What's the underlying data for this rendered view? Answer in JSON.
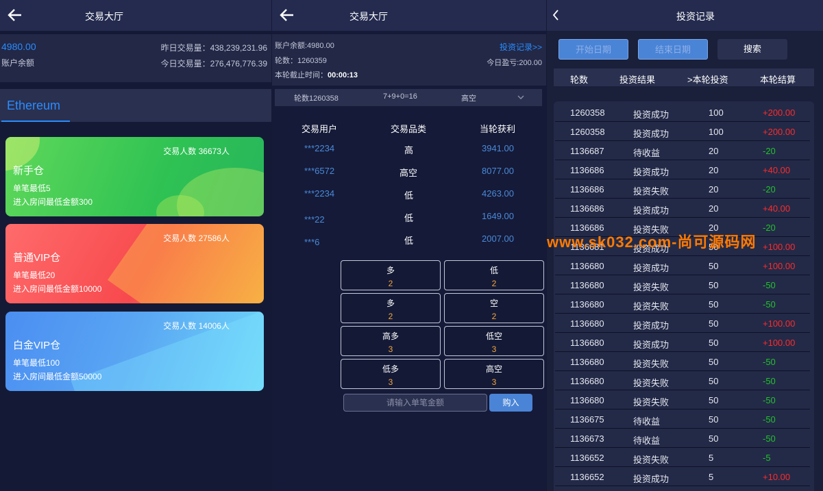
{
  "hall": {
    "title": "交易大厅",
    "balance": "4980.00",
    "balance_label": "账户余额",
    "yesterday_volume": "昨日交易量：438,239,231.96",
    "today_volume": "今日交易量：276,476,776.39",
    "tab": "Ethereum",
    "rooms": [
      {
        "name": "新手仓",
        "count": "交易人数 36673人",
        "min": "单笔最低5",
        "enter": "进入房间最低金额300"
      },
      {
        "name": "普通VIP仓",
        "count": "交易人数 27586人",
        "min": "单笔最低20",
        "enter": "进入房间最低金额10000"
      },
      {
        "name": "白金VIP仓",
        "count": "交易人数 14006人",
        "min": "单笔最低100",
        "enter": "进入房间最低金额50000"
      }
    ]
  },
  "trade": {
    "title": "交易大厅",
    "balance": "账户余额:4980.00",
    "round": "轮数：1260359",
    "deadline_label": "本轮截止时间：",
    "deadline": "00:00:13",
    "record_link": "投资记录>>",
    "today_pl": "今日盈亏:200.00",
    "last_round": "轮数1260358",
    "last_sum": "7+9+0=16",
    "last_result": "高空",
    "headers": [
      "交易用户",
      "交易品类",
      "当轮获利"
    ],
    "rows": [
      {
        "user": "***2234",
        "type": "高",
        "profit": "3941.00"
      },
      {
        "user": "***6572",
        "type": "高空",
        "profit": "8077.00"
      },
      {
        "user": "***2234",
        "type": "低",
        "profit": "4263.00"
      },
      {
        "user": "***22",
        "type": "低",
        "profit": "1649.00"
      },
      {
        "user": "***6",
        "type": "低",
        "profit": "2007.00"
      }
    ],
    "options": [
      {
        "label": "多",
        "odds": "2"
      },
      {
        "label": "低",
        "odds": "2"
      },
      {
        "label": "多",
        "odds": "2"
      },
      {
        "label": "空",
        "odds": "2"
      },
      {
        "label": "高多",
        "odds": "3"
      },
      {
        "label": "低空",
        "odds": "3"
      },
      {
        "label": "低多",
        "odds": "3"
      },
      {
        "label": "高空",
        "odds": "3"
      }
    ],
    "amount_placeholder": "请输入单笔金额",
    "buy": "购入"
  },
  "records": {
    "title": "投资记录",
    "start_btn": "开始日期",
    "end_btn": "结束日期",
    "search_btn": "搜索",
    "headers": [
      "轮数",
      "投资结果",
      ">本轮投资",
      "本轮结算"
    ],
    "rows": [
      {
        "round": "1260358",
        "result": "投资成功",
        "amount": "100",
        "settle": "+200.00",
        "tone": "pos"
      },
      {
        "round": "1260358",
        "result": "投资成功",
        "amount": "100",
        "settle": "+200.00",
        "tone": "pos"
      },
      {
        "round": "1136687",
        "result": "待收益",
        "amount": "20",
        "settle": "-20",
        "tone": "neg"
      },
      {
        "round": "1136686",
        "result": "投资成功",
        "amount": "20",
        "settle": "+40.00",
        "tone": "pos"
      },
      {
        "round": "1136686",
        "result": "投资失败",
        "amount": "20",
        "settle": "-20",
        "tone": "neg"
      },
      {
        "round": "1136686",
        "result": "投资成功",
        "amount": "20",
        "settle": "+40.00",
        "tone": "pos"
      },
      {
        "round": "1136686",
        "result": "投资失败",
        "amount": "20",
        "settle": "-20",
        "tone": "neg"
      },
      {
        "round": "1136681",
        "result": "投资成功",
        "amount": "50",
        "settle": "+100.00",
        "tone": "pos"
      },
      {
        "round": "1136680",
        "result": "投资成功",
        "amount": "50",
        "settle": "+100.00",
        "tone": "pos"
      },
      {
        "round": "1136680",
        "result": "投资失败",
        "amount": "50",
        "settle": "-50",
        "tone": "neg"
      },
      {
        "round": "1136680",
        "result": "投资失败",
        "amount": "50",
        "settle": "-50",
        "tone": "neg"
      },
      {
        "round": "1136680",
        "result": "投资成功",
        "amount": "50",
        "settle": "+100.00",
        "tone": "pos"
      },
      {
        "round": "1136680",
        "result": "投资成功",
        "amount": "50",
        "settle": "+100.00",
        "tone": "pos"
      },
      {
        "round": "1136680",
        "result": "投资失败",
        "amount": "50",
        "settle": "-50",
        "tone": "neg"
      },
      {
        "round": "1136680",
        "result": "投资失败",
        "amount": "50",
        "settle": "-50",
        "tone": "neg"
      },
      {
        "round": "1136680",
        "result": "投资失败",
        "amount": "50",
        "settle": "-50",
        "tone": "neg"
      },
      {
        "round": "1136675",
        "result": "待收益",
        "amount": "50",
        "settle": "-50",
        "tone": "neg"
      },
      {
        "round": "1136673",
        "result": "待收益",
        "amount": "50",
        "settle": "-50",
        "tone": "neg"
      },
      {
        "round": "1136652",
        "result": "投资失败",
        "amount": "5",
        "settle": "-5",
        "tone": "neg"
      },
      {
        "round": "1136652",
        "result": "投资成功",
        "amount": "5",
        "settle": "+10.00",
        "tone": "pos"
      }
    ]
  },
  "watermark": "www.sk032.com-尚可源码网",
  "colors": {
    "accent": "#2a8cff",
    "positive": "#ff2a2a",
    "negative": "#22c22a",
    "odds": "#f4a640"
  }
}
